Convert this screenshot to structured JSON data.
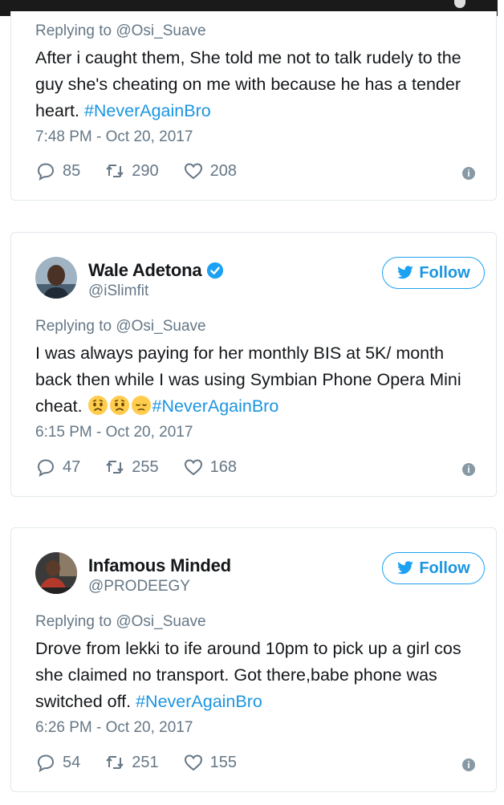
{
  "colors": {
    "accent": "#1da1f2",
    "muted": "#657786",
    "text": "#14171a",
    "border": "#e1e8ed"
  },
  "tweets": [
    {
      "reply_prefix": "Replying to ",
      "reply_to": "@Osi_Suave",
      "text_parts": [
        "After i caught them, She told me not to talk rudely to the guy she's cheating on me with because he has a tender heart. "
      ],
      "hashtag": "#NeverAgainBro",
      "time": "7:48 PM - Oct 20, 2017",
      "replies": "85",
      "retweets": "290",
      "likes": "208"
    },
    {
      "name": "Wale Adetona",
      "handle": "@iSlimfit",
      "verified": true,
      "follow_label": "Follow",
      "reply_prefix": "Replying to ",
      "reply_to": "@Osi_Suave",
      "text_parts": [
        "I was always paying for her monthly BIS at 5K/ month back then while I was using Symbian Phone Opera Mini cheat. "
      ],
      "emojis": [
        "worried-face",
        "worried-face",
        "disappointed-face"
      ],
      "hashtag": "#NeverAgainBro",
      "time": "6:15 PM - Oct 20, 2017",
      "replies": "47",
      "retweets": "255",
      "likes": "168"
    },
    {
      "name": "Infamous Minded",
      "handle": "@PRODEEGY",
      "verified": false,
      "follow_label": "Follow",
      "reply_prefix": "Replying to ",
      "reply_to": "@Osi_Suave",
      "text_parts": [
        "Drove from lekki to ife around 10pm to pick up a girl cos she claimed no transport. Got there,babe phone was switched off. "
      ],
      "hashtag": "#NeverAgainBro",
      "time": "6:26 PM - Oct 20, 2017",
      "replies": "54",
      "retweets": "251",
      "likes": "155"
    }
  ]
}
